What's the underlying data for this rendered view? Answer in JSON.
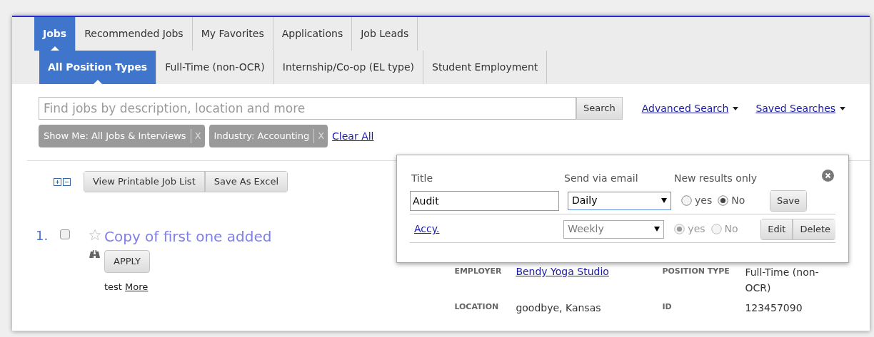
{
  "tabs": [
    {
      "label": "Jobs",
      "selected": true
    },
    {
      "label": "Recommended Jobs",
      "selected": false
    },
    {
      "label": "My Favorites",
      "selected": false
    },
    {
      "label": "Applications",
      "selected": false
    },
    {
      "label": "Job Leads",
      "selected": false
    }
  ],
  "subtabs": [
    {
      "label": "All Position Types",
      "selected": true
    },
    {
      "label": "Full-Time (non-OCR)",
      "selected": false
    },
    {
      "label": "Internship/Co-op (EL type)",
      "selected": false
    },
    {
      "label": "Student Employment",
      "selected": false
    }
  ],
  "search": {
    "placeholder": "Find jobs by description, location and more",
    "button": "Search"
  },
  "links": [
    {
      "label": "Advanced Search"
    },
    {
      "label": "Saved Searches"
    }
  ],
  "filters": [
    {
      "label": "Show Me: All Jobs & Interviews",
      "remove": "X"
    },
    {
      "label": "Industry: Accounting",
      "remove": "X"
    }
  ],
  "clear_all": "Clear All",
  "toolbar": [
    "View Printable Job List",
    "Save As Excel"
  ],
  "job": {
    "number": "1.",
    "checked": false,
    "favorite": false,
    "title": "Copy of first one added",
    "apply": "APPLY",
    "description": "test",
    "more": "More",
    "details": [
      {
        "label": "EMPLOYER",
        "value": "Bendy Yoga Studio",
        "kind": "link"
      },
      {
        "label": "POSITION TYPE",
        "value": "Full-Time (non-OCR)",
        "kind": "text"
      },
      {
        "label": "LOCATION",
        "value": "goodbye, Kansas",
        "kind": "text"
      },
      {
        "label": "ID",
        "value": "123457090",
        "kind": "text"
      }
    ]
  },
  "saved_search_popup": {
    "columns": [
      "Title",
      "Send via email",
      "New results only"
    ],
    "rows": [
      {
        "kind": "edit",
        "title": "Audit",
        "frequency": "Daily",
        "disabled": false,
        "options": [
          {
            "label": "yes",
            "selected": false
          },
          {
            "label": "No",
            "selected": true
          }
        ],
        "buttons": [
          "Save"
        ]
      },
      {
        "kind": "saved",
        "title": "Accy.",
        "frequency": "Weekly",
        "disabled": true,
        "options": [
          {
            "label": "yes",
            "selected": true
          },
          {
            "label": "No",
            "selected": false
          }
        ],
        "buttons": [
          "Edit",
          "Delete"
        ]
      }
    ]
  }
}
